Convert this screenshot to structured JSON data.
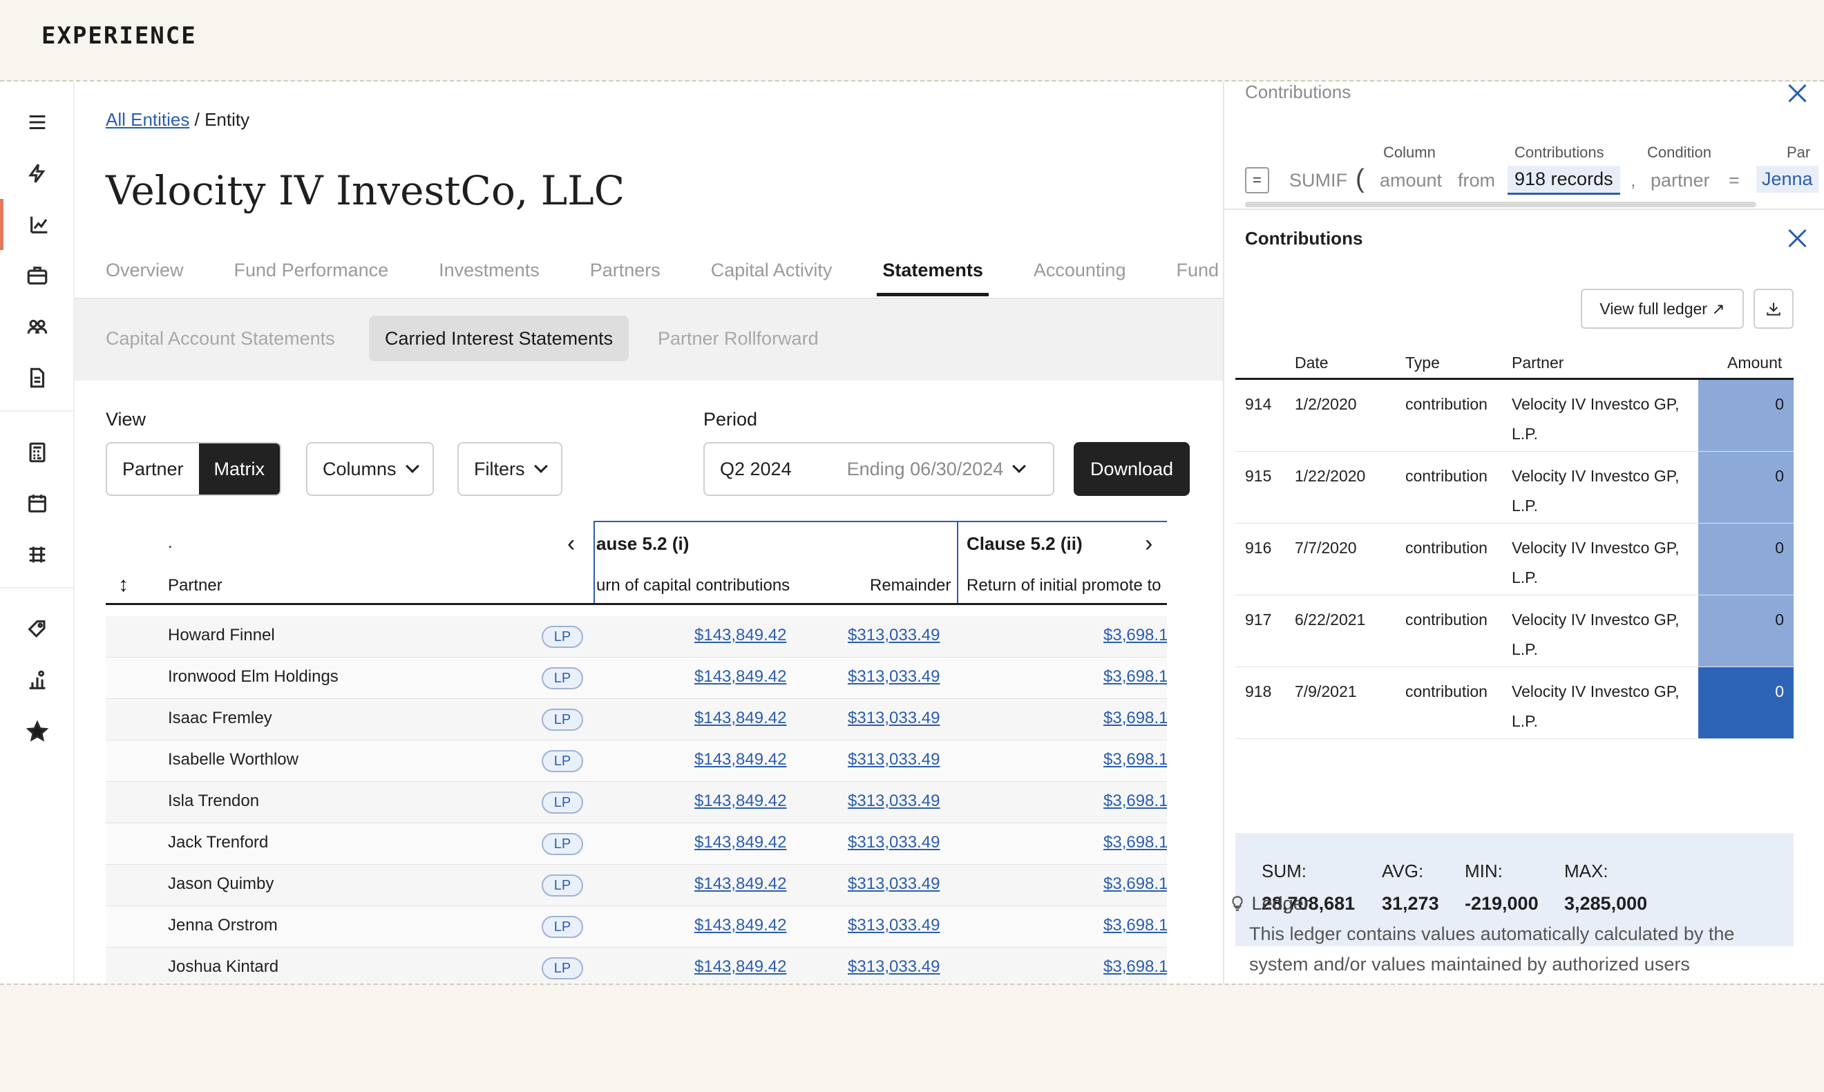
{
  "brand": "EXPERIENCE",
  "breadcrumb": {
    "root": "All Entities",
    "sep": "/",
    "current": "Entity"
  },
  "title": "Velocity IV InvestCo, LLC",
  "tabs": [
    "Overview",
    "Fund Performance",
    "Investments",
    "Partners",
    "Capital Activity",
    "Statements",
    "Accounting",
    "Fund"
  ],
  "active_tab": "Statements",
  "subtabs": [
    "Capital Account Statements",
    "Carried Interest Statements",
    "Partner Rollforward"
  ],
  "controls": {
    "view_label": "View",
    "view_partner": "Partner",
    "view_matrix": "Matrix",
    "columns": "Columns",
    "filters": "Filters",
    "period_label": "Period",
    "period_value": "Q2 2024",
    "period_ending": "Ending 06/30/2024",
    "download": "Download"
  },
  "table": {
    "dot": ".",
    "partner_header": "Partner",
    "clause1": "ause 5.2 (i)",
    "clause1_sub": "urn of capital contributions",
    "remainder": "Remainder",
    "clause2": "Clause 5.2 (ii)",
    "clause2_sub": "Return of initial promote to",
    "rows": [
      {
        "name": "Howard Finnel",
        "type": "LP",
        "c1": "$143,849.42",
        "rem": "$313,033.49",
        "c2": "$3,698.1"
      },
      {
        "name": "Ironwood Elm Holdings",
        "type": "LP",
        "c1": "$143,849.42",
        "rem": "$313,033.49",
        "c2": "$3,698.1"
      },
      {
        "name": "Isaac Fremley",
        "type": "LP",
        "c1": "$143,849.42",
        "rem": "$313,033.49",
        "c2": "$3,698.1"
      },
      {
        "name": "Isabelle Worthlow",
        "type": "LP",
        "c1": "$143,849.42",
        "rem": "$313,033.49",
        "c2": "$3,698.1"
      },
      {
        "name": "Isla Trendon",
        "type": "LP",
        "c1": "$143,849.42",
        "rem": "$313,033.49",
        "c2": "$3,698.1"
      },
      {
        "name": "Jack Trenford",
        "type": "LP",
        "c1": "$143,849.42",
        "rem": "$313,033.49",
        "c2": "$3,698.1"
      },
      {
        "name": "Jason Quimby",
        "type": "LP",
        "c1": "$143,849.42",
        "rem": "$313,033.49",
        "c2": "$3,698.1"
      },
      {
        "name": "Jenna Orstrom",
        "type": "LP",
        "c1": "$143,849.42",
        "rem": "$313,033.49",
        "c2": "$3,698.1"
      },
      {
        "name": "Joshua Kintard",
        "type": "LP",
        "c1": "$143,849.42",
        "rem": "$313,033.49",
        "c2": "$3,698.1"
      }
    ]
  },
  "formula": {
    "title": "Contributions",
    "eq": "=",
    "fn": "SUMIF",
    "paren": "(",
    "col_label": "Column",
    "col_value": "amount",
    "from": "from",
    "src_label": "Contributions",
    "src_value": "918 records",
    "comma": ",",
    "cond_label": "Condition",
    "cond_value": "partner",
    "equals": "=",
    "par_label": "Par",
    "par_value": "Jenna"
  },
  "ledger": {
    "title": "Contributions",
    "view_full": "View full ledger ↗",
    "headers": [
      "Date",
      "Type",
      "Partner",
      "Amount"
    ],
    "rows": [
      {
        "id": "914",
        "date": "1/2/2020",
        "type": "contribution",
        "partner1": "Velocity IV Investco GP,",
        "partner2": "L.P.",
        "amount": "0"
      },
      {
        "id": "915",
        "date": "1/22/2020",
        "type": "contribution",
        "partner1": "Velocity IV Investco GP,",
        "partner2": "L.P.",
        "amount": "0"
      },
      {
        "id": "916",
        "date": "7/7/2020",
        "type": "contribution",
        "partner1": "Velocity IV Investco GP,",
        "partner2": "L.P.",
        "amount": "0"
      },
      {
        "id": "917",
        "date": "6/22/2021",
        "type": "contribution",
        "partner1": "Velocity IV Investco GP,",
        "partner2": "L.P.",
        "amount": "0"
      },
      {
        "id": "918",
        "date": "7/9/2021",
        "type": "contribution",
        "partner1": "Velocity IV Investco GP,",
        "partner2": "L.P.",
        "amount": "0"
      }
    ],
    "stats": {
      "sum_label": "SUM:",
      "sum": "28,708,681",
      "avg_label": "AVG:",
      "avg": "31,273",
      "min_label": "MIN:",
      "min": "-219,000",
      "max_label": "MAX:",
      "max": "3,285,000"
    },
    "note_title": "Ledger",
    "note_text": "This ledger contains values automatically calculated by the system and/or values maintained by authorized users"
  },
  "colors": {
    "accent": "#2a5db0",
    "rail_active": "#e07a5f",
    "amount_light": "#8ca9d8",
    "amount_dark": "#2e64b8"
  },
  "rail_icons": [
    "menu-icon",
    "bolt-icon",
    "chart-icon",
    "briefcase-icon",
    "people-icon",
    "document-icon",
    "calculator-icon",
    "calendar-icon",
    "ledger-grid-icon",
    "tag-icon",
    "chart-person-icon",
    "star-icon"
  ]
}
